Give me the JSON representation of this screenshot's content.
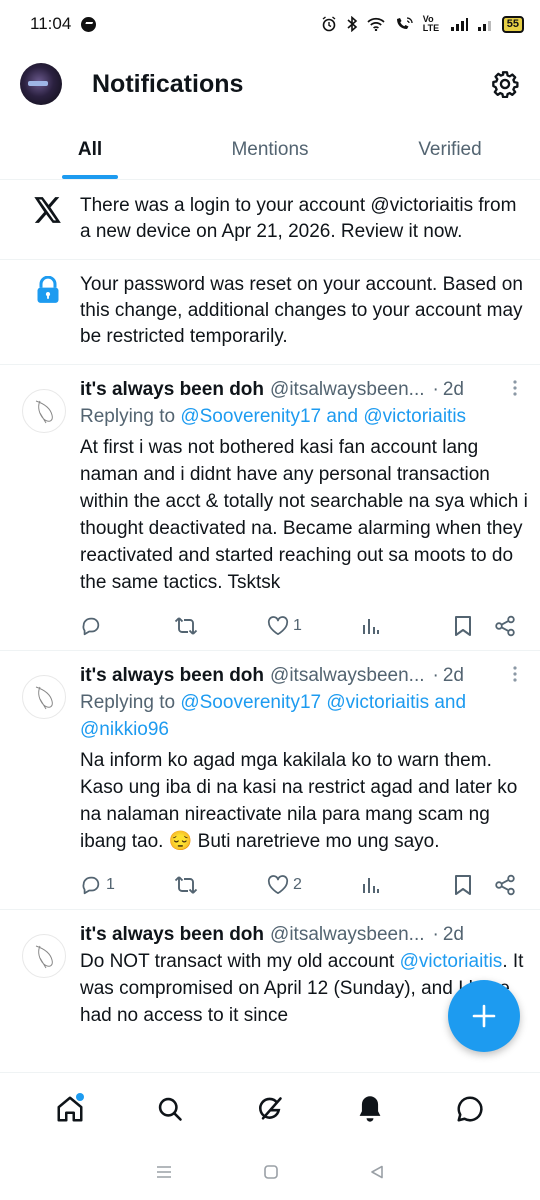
{
  "status_bar": {
    "time": "11:04",
    "network_label": "Vo LTE",
    "battery": "55"
  },
  "header": {
    "title": "Notifications"
  },
  "tabs": [
    {
      "label": "All",
      "active": true
    },
    {
      "label": "Mentions",
      "active": false
    },
    {
      "label": "Verified",
      "active": false
    }
  ],
  "system_notifications": [
    {
      "icon": "x-logo-icon",
      "text": "There was a login to your account @victoriaitis from a new device on Apr 21, 2026. Review it now."
    },
    {
      "icon": "lock-icon",
      "text": "Your password was reset on your account. Based on this change, additional changes to your account may be restricted temporarily."
    }
  ],
  "tweets": [
    {
      "name": "it's always been doh",
      "handle": "@itsalwaysbeen...",
      "time": "2d",
      "reply_prefix": "Replying to ",
      "reply_mentions": "@Sooverenity17 and @victoriaitis",
      "reply_mentions_2": "",
      "text": "At first i was not bothered kasi fan account lang naman and i didnt have any personal transaction within the acct & totally not searchable na sya which i thought deactivated na. Became alarming when they reactivated and started reaching out sa moots to do the same tactics. Tsktsk",
      "replies": "",
      "likes": "1"
    },
    {
      "name": "it's always been doh",
      "handle": "@itsalwaysbeen...",
      "time": "2d",
      "reply_prefix": "Replying to ",
      "reply_mentions": "@Sooverenity17 @victoriaitis and",
      "reply_mentions_2": "@nikkio96",
      "text": "Na inform ko agad mga kakilala ko to warn them. Kaso ung iba di na kasi na restrict agad and later ko na nalaman nireactivate nila para mang scam ng ibang tao. 😔 Buti naretrieve mo ung sayo.",
      "replies": "1",
      "likes": "2"
    },
    {
      "name": "it's always been doh",
      "handle": "@itsalwaysbeen...",
      "time": "2d",
      "text_part1": "Do NOT transact with my old account ",
      "text_link": "@victoriaitis",
      "text_part2": ". It was compromised on April 12 (Sunday), and I have had no access to it since"
    }
  ],
  "colors": {
    "accent": "#1d9bf0",
    "text_primary": "#0f1419",
    "text_secondary": "#536471"
  },
  "bottom_nav": [
    "home-icon",
    "search-icon",
    "grok-icon",
    "notifications-bell-icon",
    "messages-icon"
  ]
}
